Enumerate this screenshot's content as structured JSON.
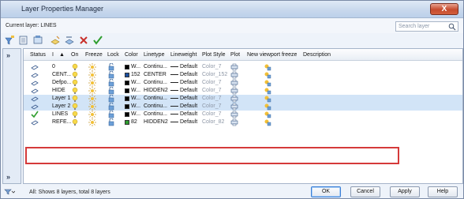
{
  "window": {
    "title": "Layer Properties Manager",
    "close_label": "X"
  },
  "current_layer_label": "Current layer: LINES",
  "search": {
    "placeholder": "Search layer"
  },
  "columns": [
    "Status",
    "",
    "On",
    "Freeze",
    "Lock",
    "Color",
    "Linetype",
    "Lineweight",
    "Plot Style",
    "Plot",
    "New viewport freeze",
    "Description"
  ],
  "sort_indicator": "▲",
  "layers": [
    {
      "name": "0",
      "color_label": "W...",
      "color_hex": "#000000",
      "linetype": "Continu...",
      "lineweight": "Default",
      "plot_style": "Color_7",
      "status": "layer",
      "on": true,
      "selected": false
    },
    {
      "name": "CENT...",
      "color_label": "152",
      "color_hex": "#1a4fa0",
      "linetype": "CENTER",
      "lineweight": "Default",
      "plot_style": "Color_152",
      "status": "layer",
      "on": true,
      "selected": false
    },
    {
      "name": "Defpo...",
      "color_label": "W...",
      "color_hex": "#000000",
      "linetype": "Continu...",
      "lineweight": "Default",
      "plot_style": "Color_7",
      "status": "layer",
      "on": true,
      "selected": false
    },
    {
      "name": "HIDE",
      "color_label": "W...",
      "color_hex": "#000000",
      "linetype": "HIDDEN2",
      "lineweight": "Default",
      "plot_style": "Color_7",
      "status": "layer",
      "on": true,
      "selected": false
    },
    {
      "name": "Layer 1",
      "color_label": "W...",
      "color_hex": "#000000",
      "linetype": "Continu...",
      "lineweight": "Default",
      "plot_style": "Color_7",
      "status": "layer",
      "on": true,
      "selected": true
    },
    {
      "name": "Layer 2",
      "color_label": "W...",
      "color_hex": "#000000",
      "linetype": "Continu...",
      "lineweight": "Default",
      "plot_style": "Color_7",
      "status": "layer",
      "on": true,
      "selected": true
    },
    {
      "name": "LINES",
      "color_label": "W...",
      "color_hex": "#000000",
      "linetype": "Continu...",
      "lineweight": "Default",
      "plot_style": "Color_7",
      "status": "current",
      "on": true,
      "selected": false
    },
    {
      "name": "REFE...",
      "color_label": "82",
      "color_hex": "#2f9e2f",
      "linetype": "HIDDEN2",
      "lineweight": "Default",
      "plot_style": "Color_82",
      "status": "layer",
      "on": true,
      "selected": false
    }
  ],
  "status_text": "All: Shows 8 layers, total 8 layers",
  "buttons": {
    "ok": "OK",
    "cancel": "Cancel",
    "apply": "Apply",
    "help": "Help"
  },
  "colors": {
    "selection_outline": "#d53a3a",
    "title_bar": "#c7d7ec",
    "current_check": "#2f9e2f"
  }
}
